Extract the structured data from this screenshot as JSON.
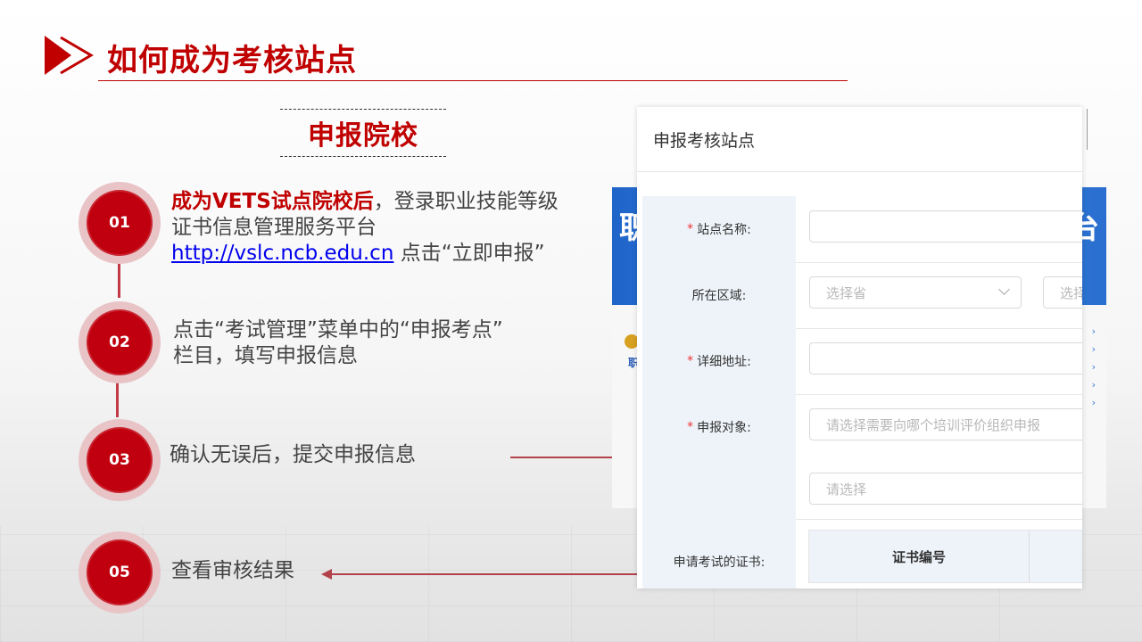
{
  "colors": {
    "accent": "#c00000",
    "circle": "#c0000e",
    "ring": "#e9c4c7",
    "link": "#0000ee"
  },
  "title": "如何成为考核站点",
  "section": "申报院校",
  "steps": [
    {
      "num": "01",
      "highlight": "成为VETS试点院校后",
      "text1": "，登录职业技能等级",
      "text2": "证书信息管理服务平台",
      "link": "http://vslc.ncb.edu.cn",
      "text3": " 点击“立即申报”"
    },
    {
      "num": "02",
      "line1": "点击“考试管理”菜单中的“申报考点”",
      "line2": "栏目，填写申报信息"
    },
    {
      "num": "03",
      "line1": "确认无误后，提交申报信息"
    },
    {
      "num": "05",
      "line1": "查看审核结果"
    }
  ],
  "background_site": {
    "banner_left": "职",
    "banner_right": "台",
    "sub": "职"
  },
  "form": {
    "title": "申报考核站点",
    "required_mark": "*",
    "rows": [
      {
        "label": "站点名称:",
        "required": true,
        "placeholder": ""
      },
      {
        "label": "所在区域:",
        "required": false,
        "placeholder": "选择省",
        "placeholder2": "选择"
      },
      {
        "label": "详细地址:",
        "required": true,
        "placeholder": ""
      },
      {
        "label": "申报对象:",
        "required": true,
        "placeholder": "请选择需要向哪个培训评价组织申报",
        "placeholder2": "请选择"
      },
      {
        "label": "申请考试的证书:",
        "required": false
      }
    ],
    "table_header": "证书编号"
  }
}
